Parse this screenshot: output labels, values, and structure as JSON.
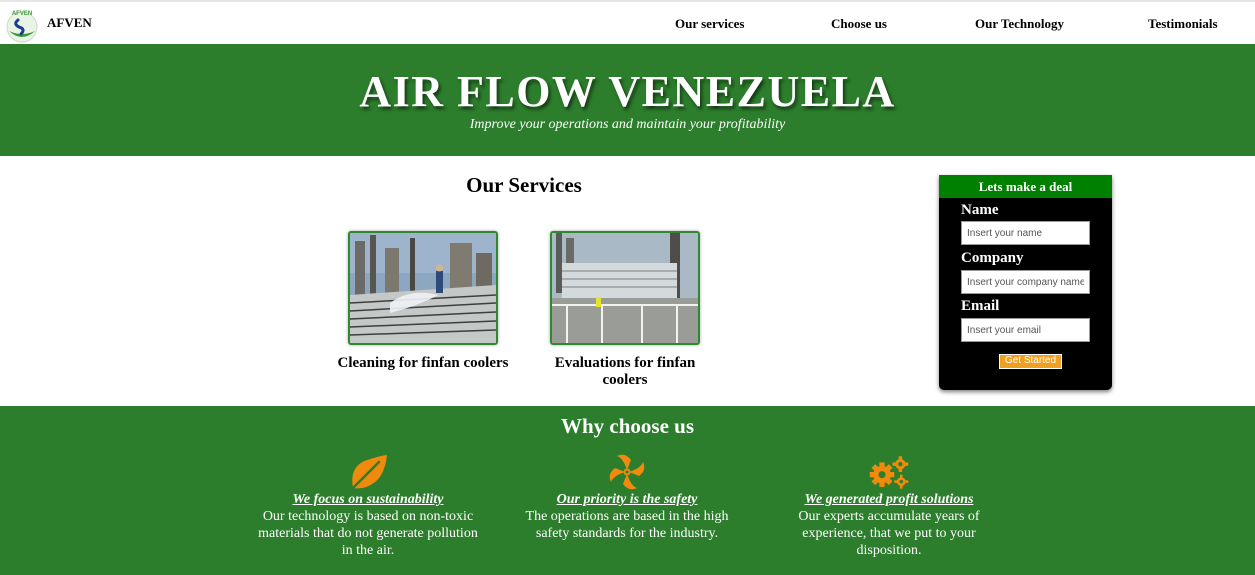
{
  "nav": {
    "logo_text": "AFVEN",
    "brand": "AFVEN",
    "links": [
      "Our services",
      "Choose us",
      "Our Technology",
      "Testimonials"
    ]
  },
  "hero": {
    "title": "AIR FLOW VENEZUELA",
    "subtitle": "Improve your operations and maintain your profitability"
  },
  "services": {
    "title": "Our Services",
    "items": [
      {
        "label": "Cleaning for finfan coolers"
      },
      {
        "label": "Evaluations for finfan coolers"
      }
    ]
  },
  "deal": {
    "heading": "Lets make a deal",
    "fields": [
      {
        "label": "Name",
        "placeholder": "Insert your name"
      },
      {
        "label": "Company",
        "placeholder": "Insert your company name"
      },
      {
        "label": "Email",
        "placeholder": "Insert your email"
      }
    ],
    "button": "Get Started"
  },
  "why": {
    "title": "Why choose us",
    "features": [
      {
        "icon": "leaf-icon",
        "heading": "We focus on sustainability",
        "text": "Our technology is based on non-toxic materials that do not generate pollution in the air."
      },
      {
        "icon": "fan-icon",
        "heading": "Our priority is the safety",
        "text": "The operations are based in the high safety standards for the industry."
      },
      {
        "icon": "gears-icon",
        "heading": "We generated profit solutions",
        "text": "Our experts accumulate years of experience, that we put to your disposition."
      }
    ]
  },
  "colors": {
    "primary_green": "#2c7d2c",
    "deal_header_green": "#008000",
    "accent_orange": "#f08a0c",
    "form_bg": "#000000"
  }
}
